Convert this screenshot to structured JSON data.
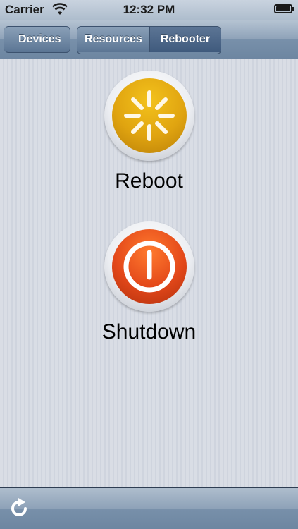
{
  "status_bar": {
    "carrier": "Carrier",
    "time": "12:32 PM"
  },
  "nav": {
    "back_label": "Devices",
    "segments": [
      "Resources",
      "Rebooter"
    ],
    "selected_segment": "Rebooter"
  },
  "actions": [
    {
      "label": "Reboot",
      "icon": "reboot-icon",
      "color": "#e0a410"
    },
    {
      "label": "Shutdown",
      "icon": "power-icon",
      "color": "#e3481a"
    }
  ],
  "toolbar": {
    "icon": "refresh-icon"
  }
}
